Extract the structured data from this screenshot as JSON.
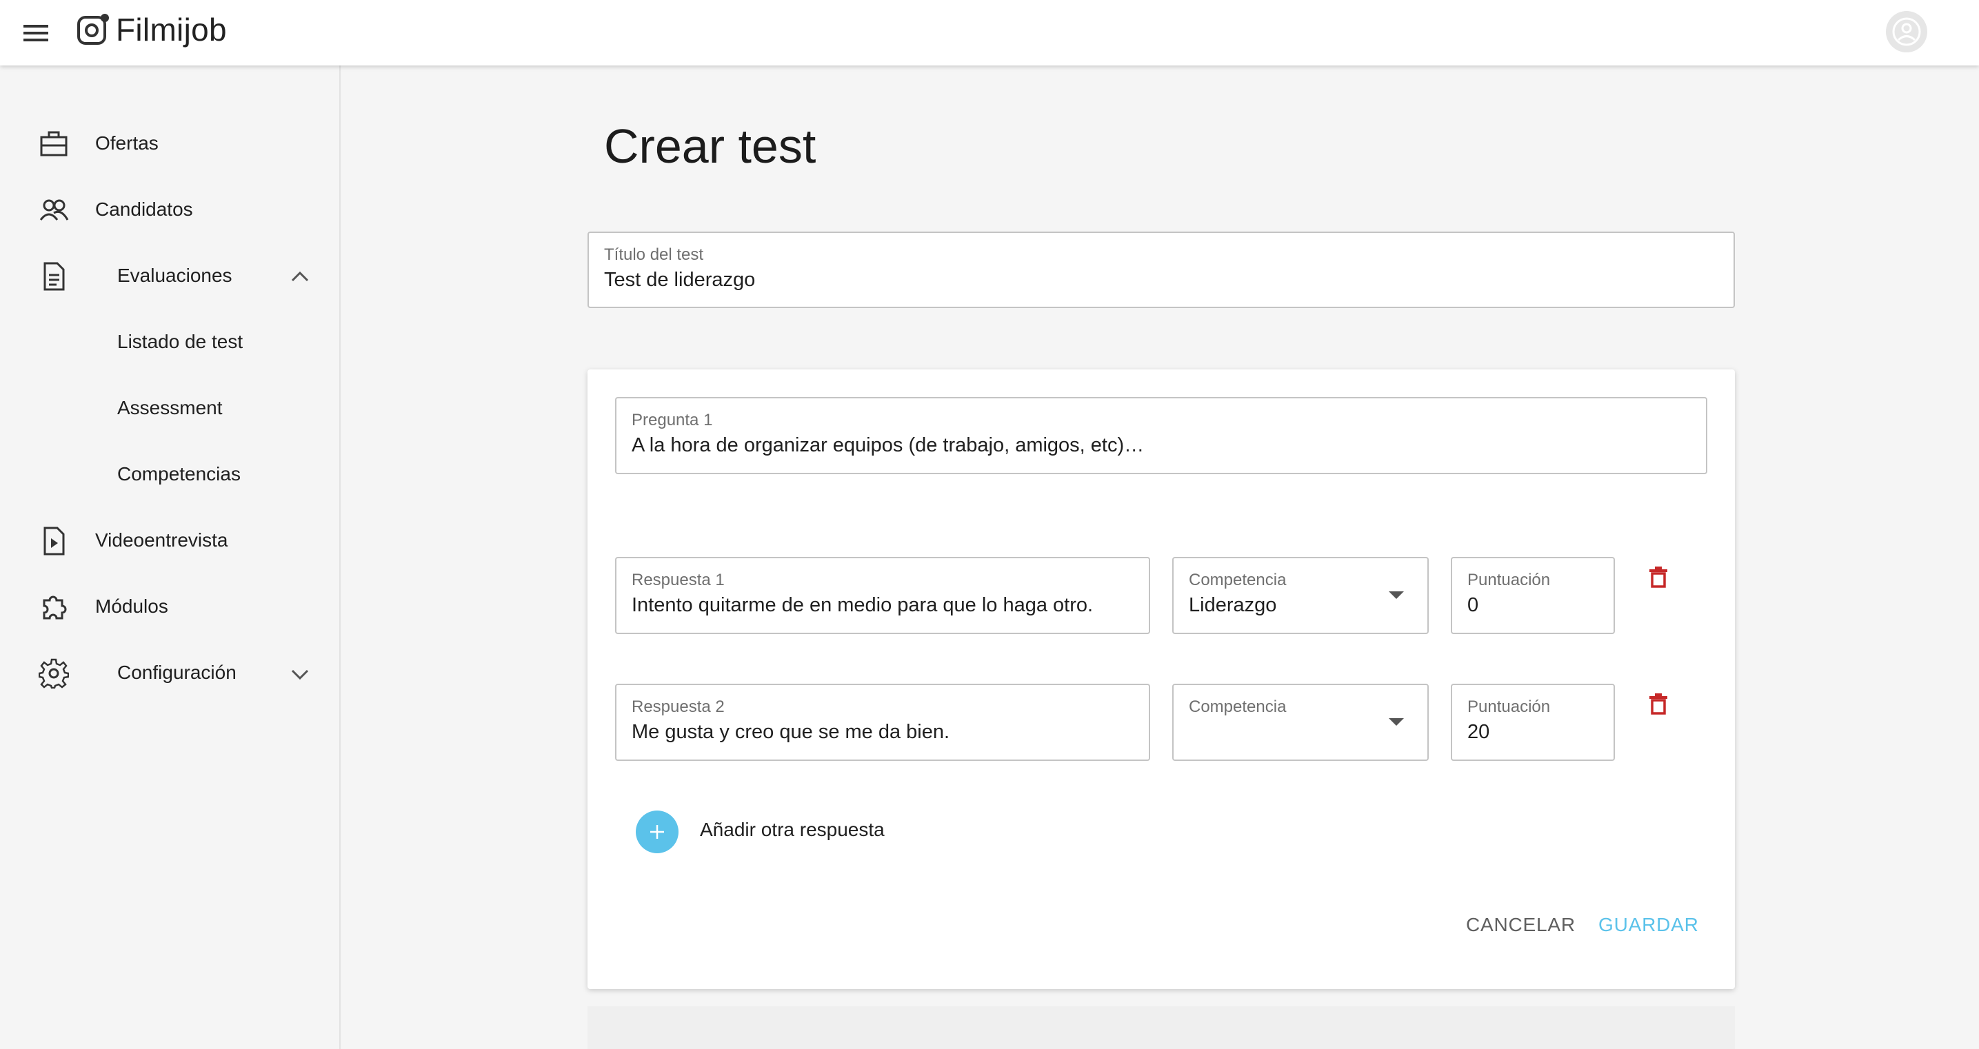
{
  "app": {
    "name": "Filmijob"
  },
  "sidebar": {
    "items": [
      {
        "label": "Ofertas",
        "icon": "briefcase-icon"
      },
      {
        "label": "Candidatos",
        "icon": "people-icon"
      },
      {
        "label": "Evaluaciones",
        "icon": "document-icon",
        "expanded": true
      },
      {
        "label": "Listado de test"
      },
      {
        "label": "Assessment"
      },
      {
        "label": "Competencias"
      },
      {
        "label": "Videoentrevista",
        "icon": "video-file-icon"
      },
      {
        "label": "Módulos",
        "icon": "puzzle-icon"
      },
      {
        "label": "Configuración",
        "icon": "gear-icon",
        "expanded": false
      }
    ]
  },
  "page": {
    "title": "Crear test"
  },
  "test_title": {
    "label": "Título del test",
    "value": "Test de liderazgo"
  },
  "question": {
    "label": "Pregunta 1",
    "value": "A la hora de organizar equipos (de trabajo, amigos, etc)…"
  },
  "answers": [
    {
      "label": "Respuesta 1",
      "value": "Intento quitarme de en medio para que lo haga otro.",
      "competencia_label": "Competencia",
      "competencia_value": "Liderazgo",
      "score_label": "Puntuación",
      "score_value": "0"
    },
    {
      "label": "Respuesta 2",
      "value": "Me gusta y creo que se me da bien.",
      "competencia_label": "Competencia",
      "competencia_value": "",
      "score_label": "Puntuación",
      "score_value": "20"
    }
  ],
  "add_answer_label": "Añadir otra respuesta",
  "actions": {
    "cancel": "CANCELAR",
    "save": "GUARDAR"
  },
  "colors": {
    "accent": "#5bc2ea",
    "delete": "#c62828"
  }
}
